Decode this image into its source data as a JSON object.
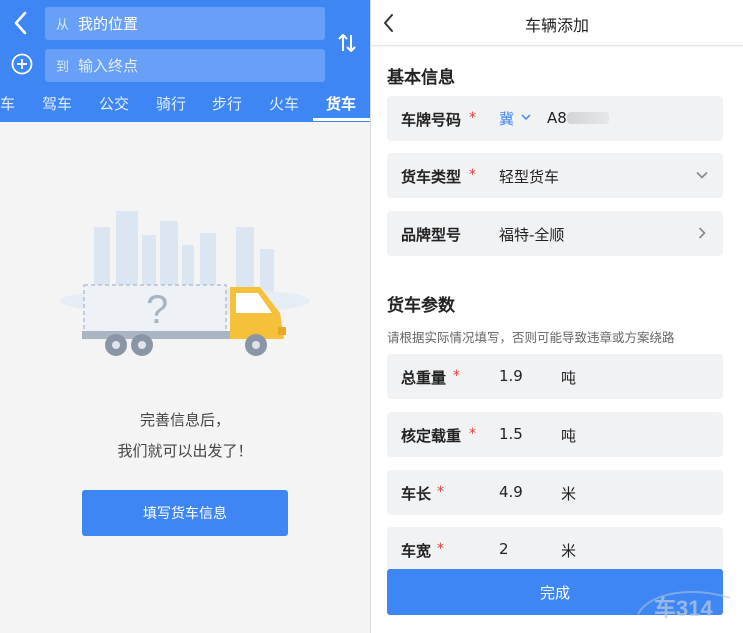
{
  "left": {
    "from_prefix": "从",
    "from_value": "我的位置",
    "to_prefix": "到",
    "to_placeholder": "输入终点",
    "tabs": [
      "车",
      "驾车",
      "公交",
      "骑行",
      "步行",
      "火车",
      "货车"
    ],
    "active_tab": "货车",
    "empty_line1": "完善信息后，",
    "empty_line2": "我们就可以出发了！",
    "fill_button": "填写货车信息"
  },
  "right": {
    "title": "车辆添加",
    "basic_section": "基本信息",
    "plate_label": "车牌号码",
    "plate_province": "冀",
    "plate_prefix": "A8",
    "truck_type_label": "货车类型",
    "truck_type_value": "轻型货车",
    "brand_label": "品牌型号",
    "brand_value": "福特-全顺",
    "params_section": "货车参数",
    "params_note": "请根据实际情况填写，否则可能导致违章或方案绕路",
    "params": [
      {
        "label": "总重量",
        "value": "1.9",
        "unit": "吨"
      },
      {
        "label": "核定载重",
        "value": "1.5",
        "unit": "吨"
      },
      {
        "label": "车长",
        "value": "4.9",
        "unit": "米"
      },
      {
        "label": "车宽",
        "value": "2",
        "unit": "米"
      }
    ],
    "required_mark": "*",
    "done_button": "完成"
  },
  "watermark_text": "车314",
  "colors": {
    "primary": "#3d86f4",
    "required": "#e53935",
    "field_bg": "#f1f2f4"
  }
}
